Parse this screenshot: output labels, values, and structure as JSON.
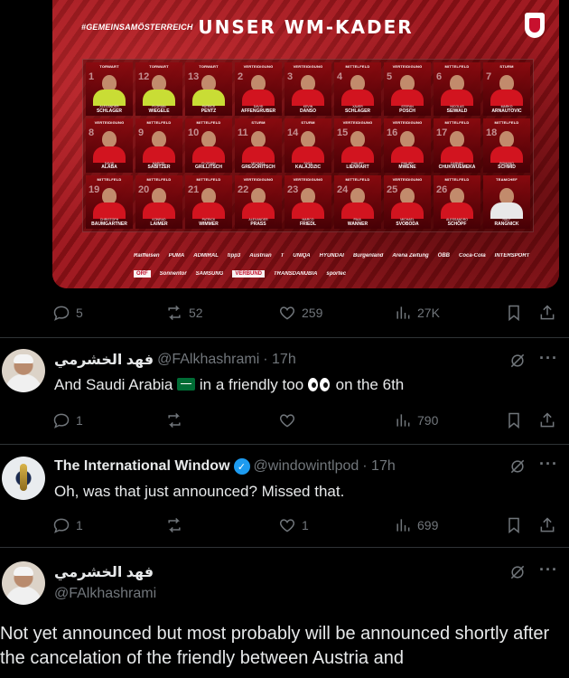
{
  "media": {
    "hashtag": "#GEMEINSAMÖSTERREICH",
    "title": "UNSER WM-KADER",
    "players": [
      {
        "pos": "TORWART",
        "num": "1",
        "first": "ALEXANDER",
        "last": "SCHLAGER",
        "type": "gk"
      },
      {
        "pos": "TORWART",
        "num": "12",
        "first": "FLORIAN",
        "last": "WIEGELE",
        "type": "gk"
      },
      {
        "pos": "TORWART",
        "num": "13",
        "first": "PATRICK",
        "last": "PENTZ",
        "type": "gk"
      },
      {
        "pos": "VERTEIDIGUNG",
        "num": "2",
        "first": "DAVID",
        "last": "AFFENGRUBER",
        "type": ""
      },
      {
        "pos": "VERTEIDIGUNG",
        "num": "3",
        "first": "KEVIN",
        "last": "DANSO",
        "type": ""
      },
      {
        "pos": "MITTELFELD",
        "num": "4",
        "first": "XAVER",
        "last": "SCHLAGER",
        "type": ""
      },
      {
        "pos": "VERTEIDIGUNG",
        "num": "5",
        "first": "STEFAN",
        "last": "POSCH",
        "type": ""
      },
      {
        "pos": "MITTELFELD",
        "num": "6",
        "first": "NICOLAS",
        "last": "SEIWALD",
        "type": ""
      },
      {
        "pos": "STURM",
        "num": "7",
        "first": "MARKO",
        "last": "ARNAUTOVIC",
        "type": ""
      },
      {
        "pos": "VERTEIDIGUNG",
        "num": "8",
        "first": "DAVID",
        "last": "ALABA",
        "type": ""
      },
      {
        "pos": "MITTELFELD",
        "num": "9",
        "first": "MARCEL",
        "last": "SABITZER",
        "type": ""
      },
      {
        "pos": "MITTELFELD",
        "num": "10",
        "first": "FLORIAN",
        "last": "GRILLITSCH",
        "type": ""
      },
      {
        "pos": "STURM",
        "num": "11",
        "first": "MICHAEL",
        "last": "GREGORITSCH",
        "type": ""
      },
      {
        "pos": "STURM",
        "num": "14",
        "first": "SASA",
        "last": "KALAJDZIC",
        "type": ""
      },
      {
        "pos": "VERTEIDIGUNG",
        "num": "15",
        "first": "PHILIPP",
        "last": "LIENHART",
        "type": ""
      },
      {
        "pos": "VERTEIDIGUNG",
        "num": "16",
        "first": "PHILIPP",
        "last": "MWENE",
        "type": ""
      },
      {
        "pos": "MITTELFELD",
        "num": "17",
        "first": "CARNEY",
        "last": "CHUKWUEMEKA",
        "type": ""
      },
      {
        "pos": "MITTELFELD",
        "num": "18",
        "first": "ROMANO",
        "last": "SCHMID",
        "type": ""
      },
      {
        "pos": "MITTELFELD",
        "num": "19",
        "first": "CHRISTOPH",
        "last": "BAUMGARTNER",
        "type": ""
      },
      {
        "pos": "MITTELFELD",
        "num": "20",
        "first": "KONRAD",
        "last": "LAIMER",
        "type": ""
      },
      {
        "pos": "MITTELFELD",
        "num": "21",
        "first": "PATRICK",
        "last": "WIMMER",
        "type": ""
      },
      {
        "pos": "VERTEIDIGUNG",
        "num": "22",
        "first": "ALEXANDER",
        "last": "PRASS",
        "type": ""
      },
      {
        "pos": "VERTEIDIGUNG",
        "num": "23",
        "first": "MARCO",
        "last": "FRIEDL",
        "type": ""
      },
      {
        "pos": "MITTELFELD",
        "num": "24",
        "first": "PAUL",
        "last": "WANNER",
        "type": ""
      },
      {
        "pos": "VERTEIDIGUNG",
        "num": "25",
        "first": "MICHAEL",
        "last": "SVOBODA",
        "type": ""
      },
      {
        "pos": "MITTELFELD",
        "num": "26",
        "first": "ALESSANDRO",
        "last": "SCHÖPF",
        "type": ""
      },
      {
        "pos": "TEAMCHEF",
        "num": "",
        "first": "RALF",
        "last": "RANGNICK",
        "type": "coach"
      }
    ],
    "sponsors": [
      "Raiffeisen",
      "PUMA",
      "ADMIRAL",
      "tipp3",
      "Austrian",
      "T",
      "UNIQA",
      "HYUNDAI",
      "Burgenland",
      "Arena Zeitung",
      "ÖBB",
      "Coca-Cola",
      "INTERSPORT",
      "ORF",
      "Sonnentor",
      "SAMSUNG",
      "VERBUND",
      "TRANSDANUBIA",
      "sportec"
    ]
  },
  "tweet0_actions": {
    "replies": "5",
    "reposts": "52",
    "likes": "259",
    "views": "27K"
  },
  "tweet1": {
    "name": "فهد الخشرمي",
    "handle": "@FAlkhashrami",
    "time": "· 17h",
    "text_a": "And Saudi Arabia",
    "text_b": "in a friendly too",
    "text_c": "on the 6th",
    "replies": "1",
    "reposts": "",
    "likes": "",
    "views": "790"
  },
  "tweet2": {
    "name": "The International Window",
    "handle": "@windowintlpod",
    "time": "· 17h",
    "text": "Oh, was that just announced? Missed that.",
    "replies": "1",
    "reposts": "",
    "likes": "1",
    "views": "699"
  },
  "main_tweet": {
    "name": "فهد الخشرمي",
    "handle": "@FAlkhashrami",
    "text": "Not yet announced but most probably will be announced shortly after the cancelation of the friendly between Austria and"
  },
  "colors": {
    "background": "#000000",
    "text": "#e7e9ea",
    "muted": "#71767b",
    "verified": "#1d9bf0",
    "divider": "#2f3336"
  }
}
